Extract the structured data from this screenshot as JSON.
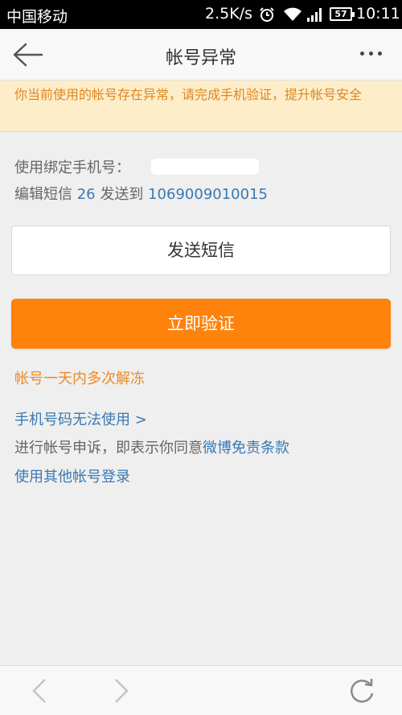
{
  "status_bar": {
    "carrier": "中国移动",
    "net_speed": "2.5K/s",
    "battery": "57",
    "time": "10:11",
    "icons": [
      "alarm-icon",
      "wifi-icon",
      "signal-icon",
      "battery-icon"
    ]
  },
  "nav": {
    "title": "帐号异常",
    "back_icon": "back-arrow-icon",
    "more_icon": "more-dots-icon"
  },
  "warning": {
    "text": "你当前使用的帐号存在异常，请完成手机验证，提升帐号安全"
  },
  "verification": {
    "phone_label": "使用绑定手机号：",
    "sms_prefix": "编辑短信",
    "sms_code": "26",
    "sms_middle": "发送到",
    "sms_number": "1069009010015"
  },
  "buttons": {
    "send_sms": "发送短信",
    "verify_now": "立即验证"
  },
  "links": {
    "unfreeze": "帐号一天内多次解冻",
    "phone_unavailable": "手机号码无法使用 >",
    "appeal_prefix": "进行帐号申诉，即表示你同意",
    "disclaimer": "微博免责条款",
    "other_login": "使用其他帐号登录"
  },
  "bottom_bar": {
    "icons": [
      "back-chevron-icon",
      "forward-chevron-icon",
      "refresh-icon"
    ]
  },
  "colors": {
    "accent": "#fe820b",
    "link_blue": "#3a79b3",
    "warning_bg": "#fdedc9",
    "warning_text": "#e0871f"
  }
}
